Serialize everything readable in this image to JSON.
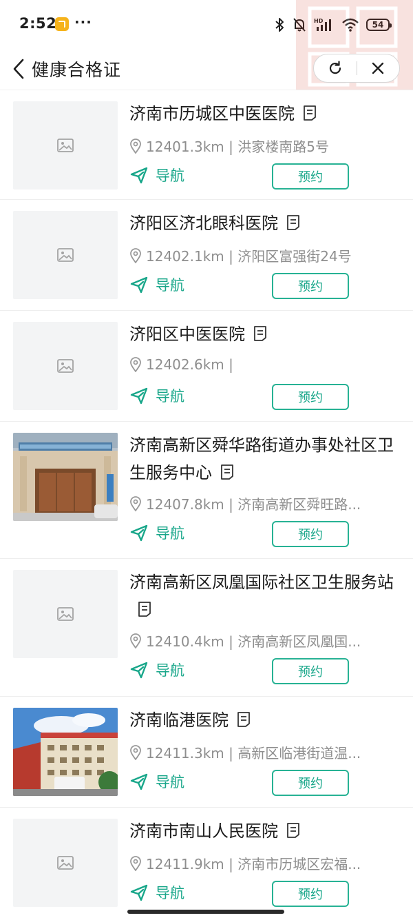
{
  "status": {
    "time": "2:52",
    "dots": "···",
    "battery": "54"
  },
  "header": {
    "title": "健康合格证"
  },
  "navigate_label": "导航",
  "book_label": "预约",
  "hospitals": [
    {
      "name": "济南市历城区中医医院",
      "distance": "12401.3km",
      "address": "洪家楼南路5号",
      "meta": "12401.3km | 洪家楼南路5号",
      "image": "placeholder"
    },
    {
      "name": "济阳区济北眼科医院",
      "distance": "12402.1km",
      "address": "济阳区富强街24号",
      "meta": "12402.1km | 济阳区富强街24号",
      "image": "placeholder"
    },
    {
      "name": "济阳区中医医院",
      "distance": "12402.6km",
      "address": "",
      "meta": "12402.6km |",
      "image": "placeholder"
    },
    {
      "name": "济南高新区舜华路街道办事处社区卫生服务中心",
      "distance": "12407.8km",
      "address": "济南高新区舜旺路...",
      "meta": "12407.8km | 济南高新区舜旺路...",
      "image": "building-photo"
    },
    {
      "name": "济南高新区凤凰国际社区卫生服务站",
      "distance": "12410.4km",
      "address": "济南高新区凤凰国...",
      "meta": "12410.4km | 济南高新区凤凰国...",
      "image": "placeholder"
    },
    {
      "name": "济南临港医院",
      "distance": "12411.3km",
      "address": "高新区临港街道温...",
      "meta": "12411.3km | 高新区临港街道温...",
      "image": "hospital-photo"
    },
    {
      "name": "济南市南山人民医院",
      "distance": "12411.9km",
      "address": "济南市历城区宏福...",
      "meta": "12411.9km | 济南市历城区宏福...",
      "image": "placeholder"
    }
  ],
  "colors": {
    "accent": "#17a689",
    "accent_border": "#27b294",
    "muted_text": "#8e8e8e",
    "placeholder_bg": "#f3f4f5"
  },
  "icons": [
    "bluetooth-icon",
    "mute-bell-icon",
    "signal-icon",
    "wifi-icon",
    "battery-icon",
    "back-chevron-icon",
    "refresh-icon",
    "close-icon",
    "image-placeholder-icon",
    "document-icon",
    "location-pin-icon",
    "navigate-arrow-icon"
  ]
}
